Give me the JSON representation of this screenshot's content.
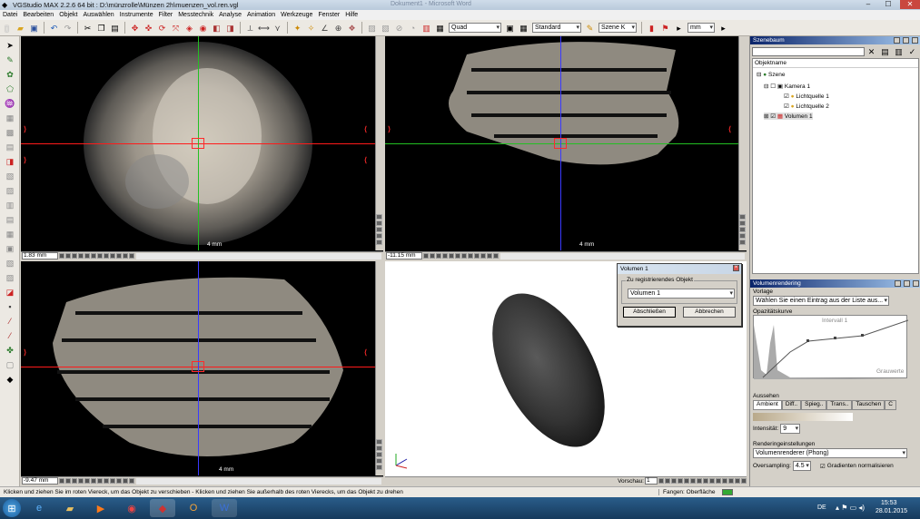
{
  "titlebar": {
    "app_title": "VGStudio MAX 2.2.6 64 bit :  D:\\münzrolle\\Münzen 2h\\muenzen_vol.ren.vgl",
    "center_text": "Dokument1 - Microsoft Word",
    "minimize": "–",
    "maximize": "☐",
    "close": "✕"
  },
  "menu": [
    "Datei",
    "Bearbeiten",
    "Objekt",
    "Auswählen",
    "Instrumente",
    "Filter",
    "Messtechnik",
    "Analyse",
    "Animation",
    "Werkzeuge",
    "Fenster",
    "Hilfe"
  ],
  "toolbar": {
    "layout_select": "Quad",
    "view_select": "Standard",
    "scene_select": "Szene K",
    "unit_select": "mm"
  },
  "viewports": {
    "top_left": {
      "zoom": "1.83 mm",
      "scale": "4 mm"
    },
    "top_right": {
      "zoom": "-11.15 mm",
      "scale": "4 mm"
    },
    "bottom_left": {
      "zoom": "-9.47 mm",
      "scale": "4 mm"
    },
    "bottom_right": {
      "preview_label": "Vorschau:",
      "preview_value": "1"
    }
  },
  "dialog": {
    "title": "Volumen 1",
    "group_label": "Zu registrierendes Objekt",
    "selected_object": "Volumen 1",
    "finish_button": "Abschließen",
    "cancel_button": "Abbrechen"
  },
  "scene_panel": {
    "title": "Szenebaum",
    "column_header": "Objektname",
    "items": [
      {
        "label": "Szene"
      },
      {
        "label": "Kamera 1"
      },
      {
        "label": "Lichtquelle 1"
      },
      {
        "label": "Lichtquelle 2"
      },
      {
        "label": "Volumen 1"
      }
    ]
  },
  "volume_panel": {
    "title": "Volumenrendering",
    "preset_label": "Vorlage",
    "preset_value": "Wählen Sie einen Eintrag aus der Liste aus...",
    "opacity_label": "Opazitätskurve",
    "interval_label": "Intervall 1",
    "grayvalue_label": "Grauwerte",
    "appearance_label": "Aussehen",
    "tabs": [
      "Ambient",
      "Diff..",
      "Spieg..",
      "Trans..",
      "Tauschen",
      "C"
    ],
    "intensity_label": "Intensität:",
    "intensity_value": "9",
    "render_settings_label": "Renderingeinstellungen",
    "renderer_value": "Volumenrenderer (Phong)",
    "oversampling_label": "Oversampling:",
    "oversampling_value": "4.5",
    "normalize_label": "Gradienten normalisieren"
  },
  "statusbar": {
    "hint": "Klicken und ziehen Sie im roten Viereck, um das Objekt zu verschieben - Klicken und ziehen Sie außerhalb des roten Vierecks, um das Objekt zu drehen",
    "snap_label": "Fangen: Oberfläche"
  },
  "taskbar": {
    "lang": "DE",
    "time": "15:53",
    "date": "28.01.2015"
  }
}
